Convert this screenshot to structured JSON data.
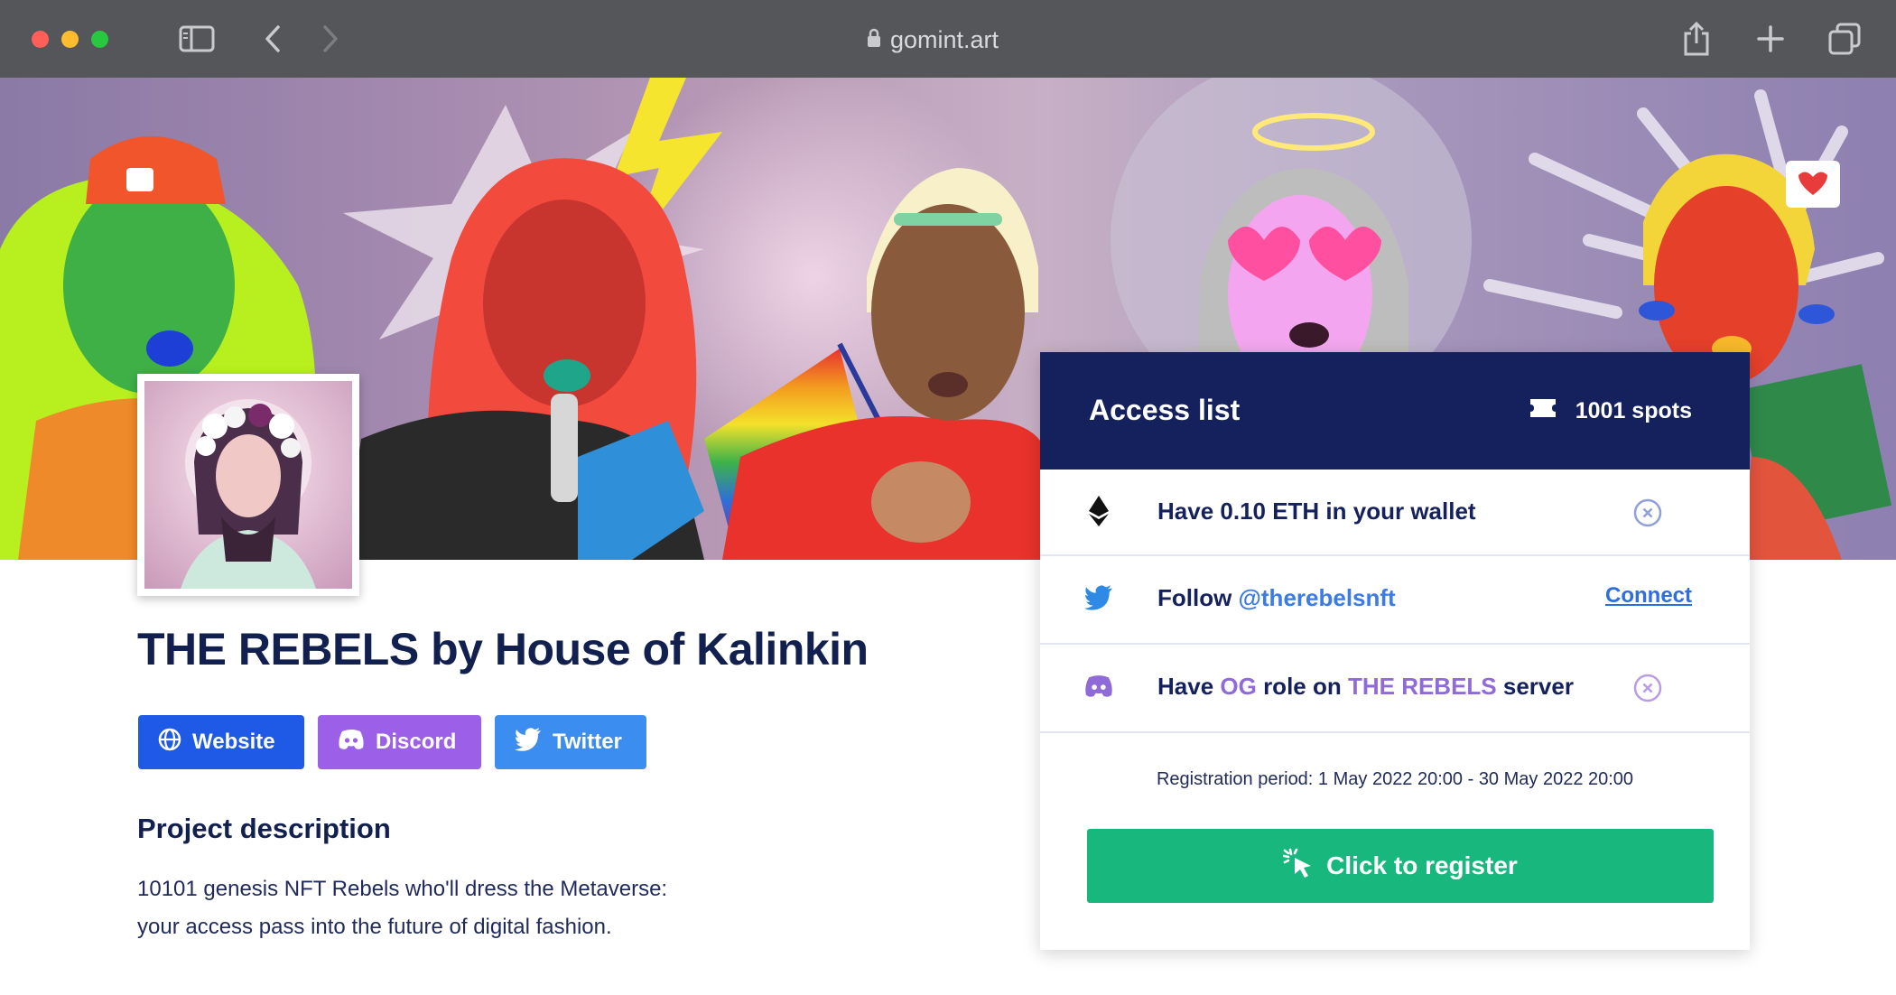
{
  "browser": {
    "url": "gomint.art",
    "icons": [
      "sidebar-icon",
      "back-icon",
      "forward-icon",
      "lock-icon",
      "share-icon",
      "new-tab-icon",
      "tabs-overview-icon"
    ]
  },
  "project": {
    "title": "THE REBELS by House of Kalinkin",
    "links": {
      "website": "Website",
      "discord": "Discord",
      "twitter": "Twitter"
    },
    "description_heading": "Project description",
    "description_line1": "10101 genesis NFT Rebels who'll dress the Metaverse:",
    "description_line2": "your access pass into the future of digital fashion."
  },
  "access_list": {
    "title": "Access list",
    "spots": "1001 spots",
    "requirements": {
      "eth": {
        "text": "Have 0.10 ETH in your wallet",
        "status": "not-met"
      },
      "twitter": {
        "prefix": "Follow ",
        "handle": "@therebelsnft",
        "action": "Connect"
      },
      "discord": {
        "prefix": "Have ",
        "role": "OG",
        "middle": " role on ",
        "server": "THE REBELS",
        "suffix": " server",
        "status": "not-met"
      }
    },
    "registration_period": "Registration period: 1 May 2022 20:00 - 30 May 2022 20:00",
    "register_button": "Click to register"
  },
  "colors": {
    "navy": "#14215c",
    "primary_blue": "#1e5ae6",
    "discord_purple": "#9b5fe8",
    "twitter_blue": "#3b8ef0",
    "register_green": "#18b77d"
  }
}
